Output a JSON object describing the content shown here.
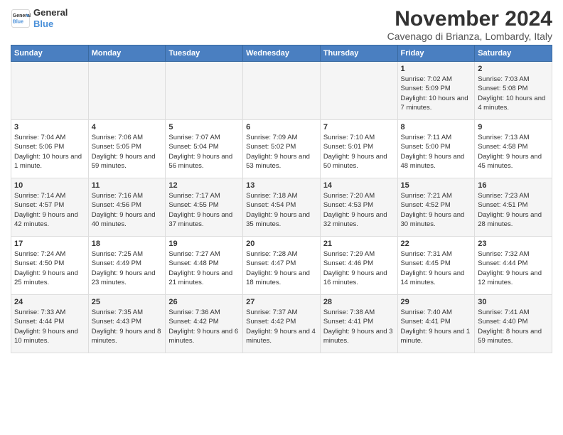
{
  "header": {
    "logo_line1": "General",
    "logo_line2": "Blue",
    "month_title": "November 2024",
    "subtitle": "Cavenago di Brianza, Lombardy, Italy"
  },
  "days_of_week": [
    "Sunday",
    "Monday",
    "Tuesday",
    "Wednesday",
    "Thursday",
    "Friday",
    "Saturday"
  ],
  "weeks": [
    [
      {
        "day": "",
        "info": ""
      },
      {
        "day": "",
        "info": ""
      },
      {
        "day": "",
        "info": ""
      },
      {
        "day": "",
        "info": ""
      },
      {
        "day": "",
        "info": ""
      },
      {
        "day": "1",
        "info": "Sunrise: 7:02 AM\nSunset: 5:09 PM\nDaylight: 10 hours and 7 minutes."
      },
      {
        "day": "2",
        "info": "Sunrise: 7:03 AM\nSunset: 5:08 PM\nDaylight: 10 hours and 4 minutes."
      }
    ],
    [
      {
        "day": "3",
        "info": "Sunrise: 7:04 AM\nSunset: 5:06 PM\nDaylight: 10 hours and 1 minute."
      },
      {
        "day": "4",
        "info": "Sunrise: 7:06 AM\nSunset: 5:05 PM\nDaylight: 9 hours and 59 minutes."
      },
      {
        "day": "5",
        "info": "Sunrise: 7:07 AM\nSunset: 5:04 PM\nDaylight: 9 hours and 56 minutes."
      },
      {
        "day": "6",
        "info": "Sunrise: 7:09 AM\nSunset: 5:02 PM\nDaylight: 9 hours and 53 minutes."
      },
      {
        "day": "7",
        "info": "Sunrise: 7:10 AM\nSunset: 5:01 PM\nDaylight: 9 hours and 50 minutes."
      },
      {
        "day": "8",
        "info": "Sunrise: 7:11 AM\nSunset: 5:00 PM\nDaylight: 9 hours and 48 minutes."
      },
      {
        "day": "9",
        "info": "Sunrise: 7:13 AM\nSunset: 4:58 PM\nDaylight: 9 hours and 45 minutes."
      }
    ],
    [
      {
        "day": "10",
        "info": "Sunrise: 7:14 AM\nSunset: 4:57 PM\nDaylight: 9 hours and 42 minutes."
      },
      {
        "day": "11",
        "info": "Sunrise: 7:16 AM\nSunset: 4:56 PM\nDaylight: 9 hours and 40 minutes."
      },
      {
        "day": "12",
        "info": "Sunrise: 7:17 AM\nSunset: 4:55 PM\nDaylight: 9 hours and 37 minutes."
      },
      {
        "day": "13",
        "info": "Sunrise: 7:18 AM\nSunset: 4:54 PM\nDaylight: 9 hours and 35 minutes."
      },
      {
        "day": "14",
        "info": "Sunrise: 7:20 AM\nSunset: 4:53 PM\nDaylight: 9 hours and 32 minutes."
      },
      {
        "day": "15",
        "info": "Sunrise: 7:21 AM\nSunset: 4:52 PM\nDaylight: 9 hours and 30 minutes."
      },
      {
        "day": "16",
        "info": "Sunrise: 7:23 AM\nSunset: 4:51 PM\nDaylight: 9 hours and 28 minutes."
      }
    ],
    [
      {
        "day": "17",
        "info": "Sunrise: 7:24 AM\nSunset: 4:50 PM\nDaylight: 9 hours and 25 minutes."
      },
      {
        "day": "18",
        "info": "Sunrise: 7:25 AM\nSunset: 4:49 PM\nDaylight: 9 hours and 23 minutes."
      },
      {
        "day": "19",
        "info": "Sunrise: 7:27 AM\nSunset: 4:48 PM\nDaylight: 9 hours and 21 minutes."
      },
      {
        "day": "20",
        "info": "Sunrise: 7:28 AM\nSunset: 4:47 PM\nDaylight: 9 hours and 18 minutes."
      },
      {
        "day": "21",
        "info": "Sunrise: 7:29 AM\nSunset: 4:46 PM\nDaylight: 9 hours and 16 minutes."
      },
      {
        "day": "22",
        "info": "Sunrise: 7:31 AM\nSunset: 4:45 PM\nDaylight: 9 hours and 14 minutes."
      },
      {
        "day": "23",
        "info": "Sunrise: 7:32 AM\nSunset: 4:44 PM\nDaylight: 9 hours and 12 minutes."
      }
    ],
    [
      {
        "day": "24",
        "info": "Sunrise: 7:33 AM\nSunset: 4:44 PM\nDaylight: 9 hours and 10 minutes."
      },
      {
        "day": "25",
        "info": "Sunrise: 7:35 AM\nSunset: 4:43 PM\nDaylight: 9 hours and 8 minutes."
      },
      {
        "day": "26",
        "info": "Sunrise: 7:36 AM\nSunset: 4:42 PM\nDaylight: 9 hours and 6 minutes."
      },
      {
        "day": "27",
        "info": "Sunrise: 7:37 AM\nSunset: 4:42 PM\nDaylight: 9 hours and 4 minutes."
      },
      {
        "day": "28",
        "info": "Sunrise: 7:38 AM\nSunset: 4:41 PM\nDaylight: 9 hours and 3 minutes."
      },
      {
        "day": "29",
        "info": "Sunrise: 7:40 AM\nSunset: 4:41 PM\nDaylight: 9 hours and 1 minute."
      },
      {
        "day": "30",
        "info": "Sunrise: 7:41 AM\nSunset: 4:40 PM\nDaylight: 8 hours and 59 minutes."
      }
    ]
  ]
}
